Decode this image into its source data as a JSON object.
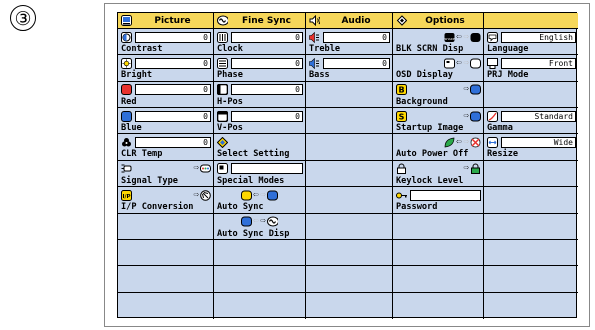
{
  "step_marker": "③",
  "tabs": [
    {
      "icon": "picture-icon",
      "label": "Picture"
    },
    {
      "icon": "fine-sync-icon",
      "label": "Fine Sync"
    },
    {
      "icon": "audio-icon",
      "label": "Audio"
    },
    {
      "icon": "options-icon",
      "label": "Options"
    },
    {
      "icon": "",
      "label": ""
    }
  ],
  "picture": [
    {
      "label": "Contrast",
      "value": "0"
    },
    {
      "label": "Bright",
      "value": "0"
    },
    {
      "label": "Red",
      "value": "0"
    },
    {
      "label": "Blue",
      "value": "0"
    },
    {
      "label": "CLR Temp",
      "value": "0"
    },
    {
      "label": "Signal Type"
    },
    {
      "label": "I/P Conversion"
    }
  ],
  "fine_sync": [
    {
      "label": "Clock",
      "value": "0"
    },
    {
      "label": "Phase",
      "value": "0"
    },
    {
      "label": "H-Pos",
      "value": "0"
    },
    {
      "label": "V-Pos",
      "value": "0"
    },
    {
      "label": "Select Setting"
    },
    {
      "label": "Special Modes"
    },
    {
      "label": "Auto Sync"
    },
    {
      "label": "Auto Sync Disp"
    }
  ],
  "audio": [
    {
      "label": "Treble",
      "value": "0"
    },
    {
      "label": "Bass",
      "value": "0"
    }
  ],
  "options": [
    {
      "label": "BLK SCRN Disp"
    },
    {
      "label": "OSD Display"
    },
    {
      "label": "Background"
    },
    {
      "label": "Startup Image"
    },
    {
      "label": "Auto Power Off"
    },
    {
      "label": "Keylock Level"
    },
    {
      "label": "Password"
    }
  ],
  "extra": [
    {
      "label": "Language",
      "value": "English"
    },
    {
      "label": "PRJ Mode",
      "value": "Front"
    },
    {
      "label": "Gamma",
      "value": "Standard"
    },
    {
      "label": "Resize",
      "value": "Wide"
    }
  ],
  "colors": {
    "header": "#f6d75a",
    "cell": "#c9d7ec",
    "red": "#e8322e",
    "blue": "#2f6fd8",
    "yellow": "#ffd800"
  }
}
